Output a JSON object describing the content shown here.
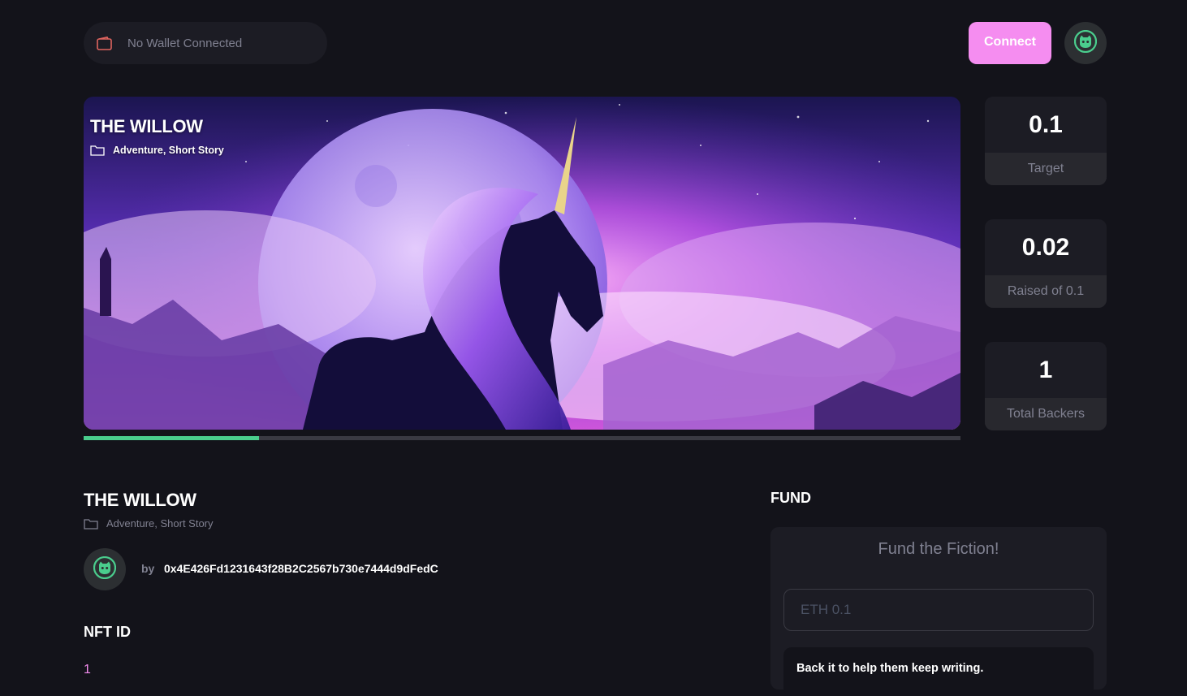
{
  "header": {
    "wallet_status": "No Wallet Connected",
    "wallet_icon": "wallet-icon",
    "connect_label": "Connect",
    "profile_icon": "cat-avatar-icon"
  },
  "banner": {
    "title": "THE WILLOW",
    "categories": "Adventure, Short Story",
    "folder_icon": "folder-icon",
    "image": "unicode-moon-illustration"
  },
  "progress": {
    "fraction": 0.2
  },
  "stats": [
    {
      "value": "0.1",
      "label": "Target"
    },
    {
      "value": "0.02",
      "label": "Raised of 0.1"
    },
    {
      "value": "1",
      "label": "Total Backers"
    }
  ],
  "story": {
    "title": "THE WILLOW",
    "categories": "Adventure, Short Story",
    "by_label": "by",
    "author_address": "0x4E426Fd1231643f28B2C2567b730e7444d9dFedC"
  },
  "nft": {
    "heading": "NFT ID",
    "value": "1"
  },
  "fund": {
    "heading": "FUND",
    "card_title": "Fund the Fiction!",
    "input_placeholder": "ETH 0.1",
    "note": "Back it to help them keep writing."
  },
  "colors": {
    "background": "#13131a",
    "card": "#1c1c24",
    "accent_pink": "#f58df0",
    "accent_green": "#4acd8d",
    "muted_text": "#808191"
  }
}
